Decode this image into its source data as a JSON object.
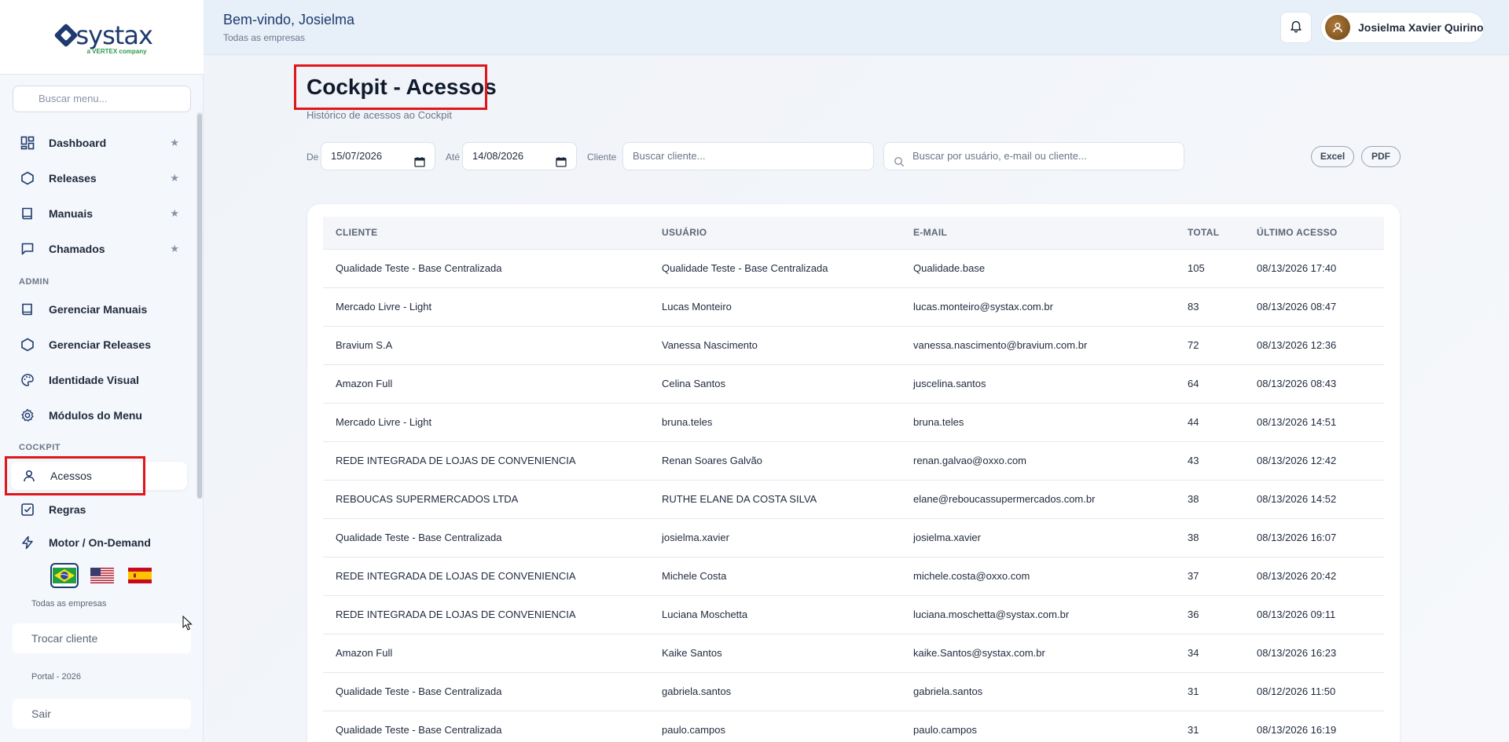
{
  "brand": {
    "name": "systax",
    "tagline": "a VERTEX company"
  },
  "sidebar": {
    "search_placeholder": "Buscar menu...",
    "items": [
      {
        "label": "Dashboard",
        "icon": "dashboard-icon",
        "starred": true
      },
      {
        "label": "Releases",
        "icon": "hexagon-icon",
        "starred": true
      },
      {
        "label": "Manuais",
        "icon": "book-icon",
        "starred": true
      },
      {
        "label": "Chamados",
        "icon": "chat-icon",
        "starred": true
      }
    ],
    "admin_label": "ADMIN",
    "admin_items": [
      {
        "label": "Gerenciar Manuais",
        "icon": "book-icon"
      },
      {
        "label": "Gerenciar Releases",
        "icon": "hexagon-icon"
      },
      {
        "label": "Identidade Visual",
        "icon": "palette-icon"
      },
      {
        "label": "Módulos do Menu",
        "icon": "gear-icon"
      }
    ],
    "cockpit_label": "COCKPIT",
    "cockpit_items": [
      {
        "label": "Acessos",
        "icon": "user-icon",
        "active": true
      },
      {
        "label": "Regras",
        "icon": "checkbox-icon"
      },
      {
        "label": "Motor / On-Demand",
        "icon": "bolt-icon"
      }
    ],
    "languages": [
      "pt-BR",
      "en-US",
      "es-ES"
    ],
    "company_scope": "Todas as empresas",
    "switch_client_label": "Trocar cliente",
    "portal_label": "Portal - 2026",
    "logout_label": "Sair"
  },
  "header": {
    "welcome": "Bem-vindo, Josielma",
    "subtitle": "Todas as empresas",
    "user_name": "Josielma Xavier Quirino"
  },
  "page": {
    "title": "Cockpit - Acessos",
    "subtitle": "Histórico de acessos ao Cockpit"
  },
  "filters": {
    "from_label": "De",
    "from_value": "15/07/2026",
    "to_label": "Até",
    "to_value": "14/08/2026",
    "client_label": "Cliente",
    "client_placeholder": "Buscar cliente...",
    "search_placeholder": "Buscar por usuário, e-mail ou cliente...",
    "excel_label": "Excel",
    "pdf_label": "PDF"
  },
  "table": {
    "columns": [
      "CLIENTE",
      "USUÁRIO",
      "E-MAIL",
      "TOTAL",
      "ÚLTIMO ACESSO"
    ],
    "rows": [
      [
        "Qualidade Teste - Base Centralizada",
        "Qualidade Teste - Base Centralizada",
        "Qualidade.base",
        "105",
        "08/13/2026 17:40"
      ],
      [
        "Mercado Livre - Light",
        "Lucas Monteiro",
        "lucas.monteiro@systax.com.br",
        "83",
        "08/13/2026 08:47"
      ],
      [
        "Bravium S.A",
        "Vanessa Nascimento",
        "vanessa.nascimento@bravium.com.br",
        "72",
        "08/13/2026 12:36"
      ],
      [
        "Amazon Full",
        "Celina Santos",
        "juscelina.santos",
        "64",
        "08/13/2026 08:43"
      ],
      [
        "Mercado Livre - Light",
        "bruna.teles",
        "bruna.teles",
        "44",
        "08/13/2026 14:51"
      ],
      [
        "REDE INTEGRADA DE LOJAS DE CONVENIENCIA",
        "Renan Soares Galvão",
        "renan.galvao@oxxo.com",
        "43",
        "08/13/2026 12:42"
      ],
      [
        "REBOUCAS SUPERMERCADOS LTDA",
        "RUTHE ELANE DA COSTA SILVA",
        "elane@reboucassupermercados.com.br",
        "38",
        "08/13/2026 14:52"
      ],
      [
        "Qualidade Teste - Base Centralizada",
        "josielma.xavier",
        "josielma.xavier",
        "38",
        "08/13/2026 16:07"
      ],
      [
        "REDE INTEGRADA DE LOJAS DE CONVENIENCIA",
        "Michele Costa",
        "michele.costa@oxxo.com",
        "37",
        "08/13/2026 20:42"
      ],
      [
        "REDE INTEGRADA DE LOJAS DE CONVENIENCIA",
        "Luciana Moschetta",
        "luciana.moschetta@systax.com.br",
        "36",
        "08/13/2026 09:11"
      ],
      [
        "Amazon Full",
        "Kaike Santos",
        "kaike.Santos@systax.com.br",
        "34",
        "08/13/2026 16:23"
      ],
      [
        "Qualidade Teste - Base Centralizada",
        "gabriela.santos",
        "gabriela.santos",
        "31",
        "08/12/2026 11:50"
      ],
      [
        "Qualidade Teste - Base Centralizada",
        "paulo.campos",
        "paulo.campos",
        "31",
        "08/13/2026 16:19"
      ]
    ]
  },
  "colors": {
    "brand": "#1e3a6e",
    "highlight": "#e0161b",
    "accent_green": "#2c9a4a"
  }
}
